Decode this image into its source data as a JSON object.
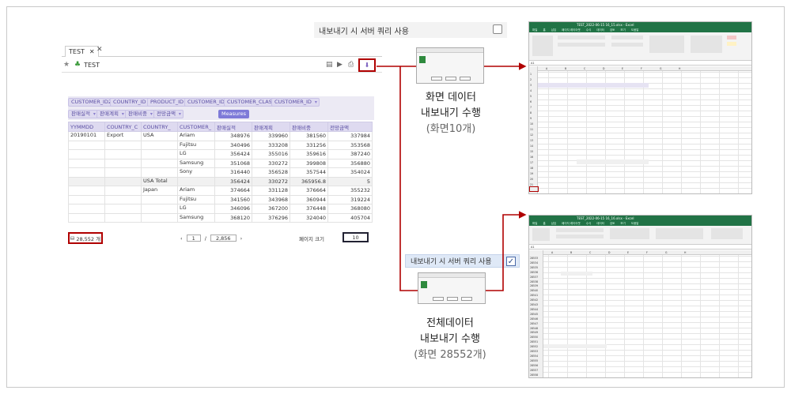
{
  "top_option": {
    "label": "내보내기 시 서버 쿼리 사용",
    "checked": false
  },
  "mid_option": {
    "label": "내보내기 시 서버 쿼리 사용",
    "checked": true,
    "check_glyph": "✓"
  },
  "app": {
    "tab_label": "TEST",
    "tab_close": "✕",
    "tab_close2": "✕",
    "report_name": "TEST",
    "star": "★"
  },
  "pivot": {
    "filter_chips_row1": [
      "CUSTOMER_ID2",
      "COUNTRY_ID",
      "PRODUCT_ID",
      "CUSTOMER_ID2",
      "CUSTOMER_CLASS",
      "CUSTOMER_ID"
    ],
    "filter_chips_row2": [
      "판매실적",
      "판매계획",
      "판매비중",
      "전망금액"
    ],
    "measures_label": "Measures",
    "headers": [
      "YYMMDD",
      "COUNTRY_C",
      "COUNTRY_",
      "CUSTOMER_",
      "판매실적",
      "판매계획",
      "판매비중",
      "전망금액"
    ],
    "rows": [
      [
        "20190101",
        "Export",
        "USA",
        "Ariam",
        "348976",
        "339960",
        "381560",
        "337984"
      ],
      [
        "",
        "",
        "",
        "Fujitsu",
        "340496",
        "333208",
        "331256",
        "353568"
      ],
      [
        "",
        "",
        "",
        "LG",
        "356424",
        "355016",
        "359616",
        "387240"
      ],
      [
        "",
        "",
        "",
        "Samsung",
        "351068",
        "330272",
        "399808",
        "356880"
      ],
      [
        "",
        "",
        "",
        "Sony",
        "316440",
        "356528",
        "357544",
        "354024"
      ],
      [
        "",
        "",
        "USA Total",
        "",
        "356424",
        "330272",
        "365956.8",
        "5"
      ],
      [
        "",
        "",
        "Japan",
        "Ariam",
        "374664",
        "331128",
        "376664",
        "355232"
      ],
      [
        "",
        "",
        "",
        "Fujitsu",
        "341560",
        "343968",
        "360944",
        "319224"
      ],
      [
        "",
        "",
        "",
        "LG",
        "346096",
        "367200",
        "376448",
        "368080"
      ],
      [
        "",
        "",
        "",
        "Samsung",
        "368120",
        "376296",
        "324040",
        "405704"
      ]
    ],
    "row_count": "28,552 개",
    "page_current": "1",
    "page_sep": "/",
    "page_total": "2,856",
    "page_prev": "‹",
    "page_next": "›",
    "page_size_label": "페이지 크기",
    "page_size_value": "10"
  },
  "captions": {
    "screen": {
      "line1": "화면 데이터",
      "line2": "내보내기 수행",
      "line3": "(화면10개)"
    },
    "full": {
      "line1": "전체데이터",
      "line2": "내보내기 수행",
      "line3": "(화면 28552개)"
    }
  },
  "excel_top": {
    "title": "TEST_2022-06-15 16_15.xlsx - Excel",
    "tabs": [
      "파일",
      "홈",
      "삽입",
      "페이지 레이아웃",
      "수식",
      "데이터",
      "검토",
      "보기",
      "도움말"
    ],
    "name_box": "A1",
    "row_numbers": [
      "1",
      "2",
      "3",
      "4",
      "5",
      "6",
      "7",
      "8",
      "9",
      "10",
      "11",
      "12",
      "13",
      "14",
      "15",
      "16",
      "17",
      "18",
      "19",
      "20",
      "21"
    ],
    "col_letters": [
      "A",
      "B",
      "C",
      "D",
      "E",
      "F",
      "G",
      "H"
    ]
  },
  "excel_bottom": {
    "title": "TEST_2022-06-15 16_16.xlsx - Excel",
    "tabs": [
      "파일",
      "홈",
      "삽입",
      "페이지 레이아웃",
      "수식",
      "데이터",
      "검토",
      "보기",
      "도움말"
    ],
    "name_box": "A1",
    "row_numbers": [
      "28533",
      "28534",
      "28535",
      "28536",
      "28537",
      "28538",
      "28539",
      "28540",
      "28541",
      "28542",
      "28543",
      "28544",
      "28545",
      "28546",
      "28547",
      "28548",
      "28549",
      "28550",
      "28551",
      "28552",
      "28553",
      "28554",
      "28555",
      "28556",
      "28557",
      "28558"
    ],
    "col_letters": [
      "A",
      "B",
      "C",
      "D",
      "E",
      "F",
      "G",
      "H"
    ]
  },
  "colors": {
    "accent_red": "#b00000",
    "pivot_header": "#dedaf0",
    "measures": "#7e7ad8",
    "excel_green": "#217346"
  }
}
